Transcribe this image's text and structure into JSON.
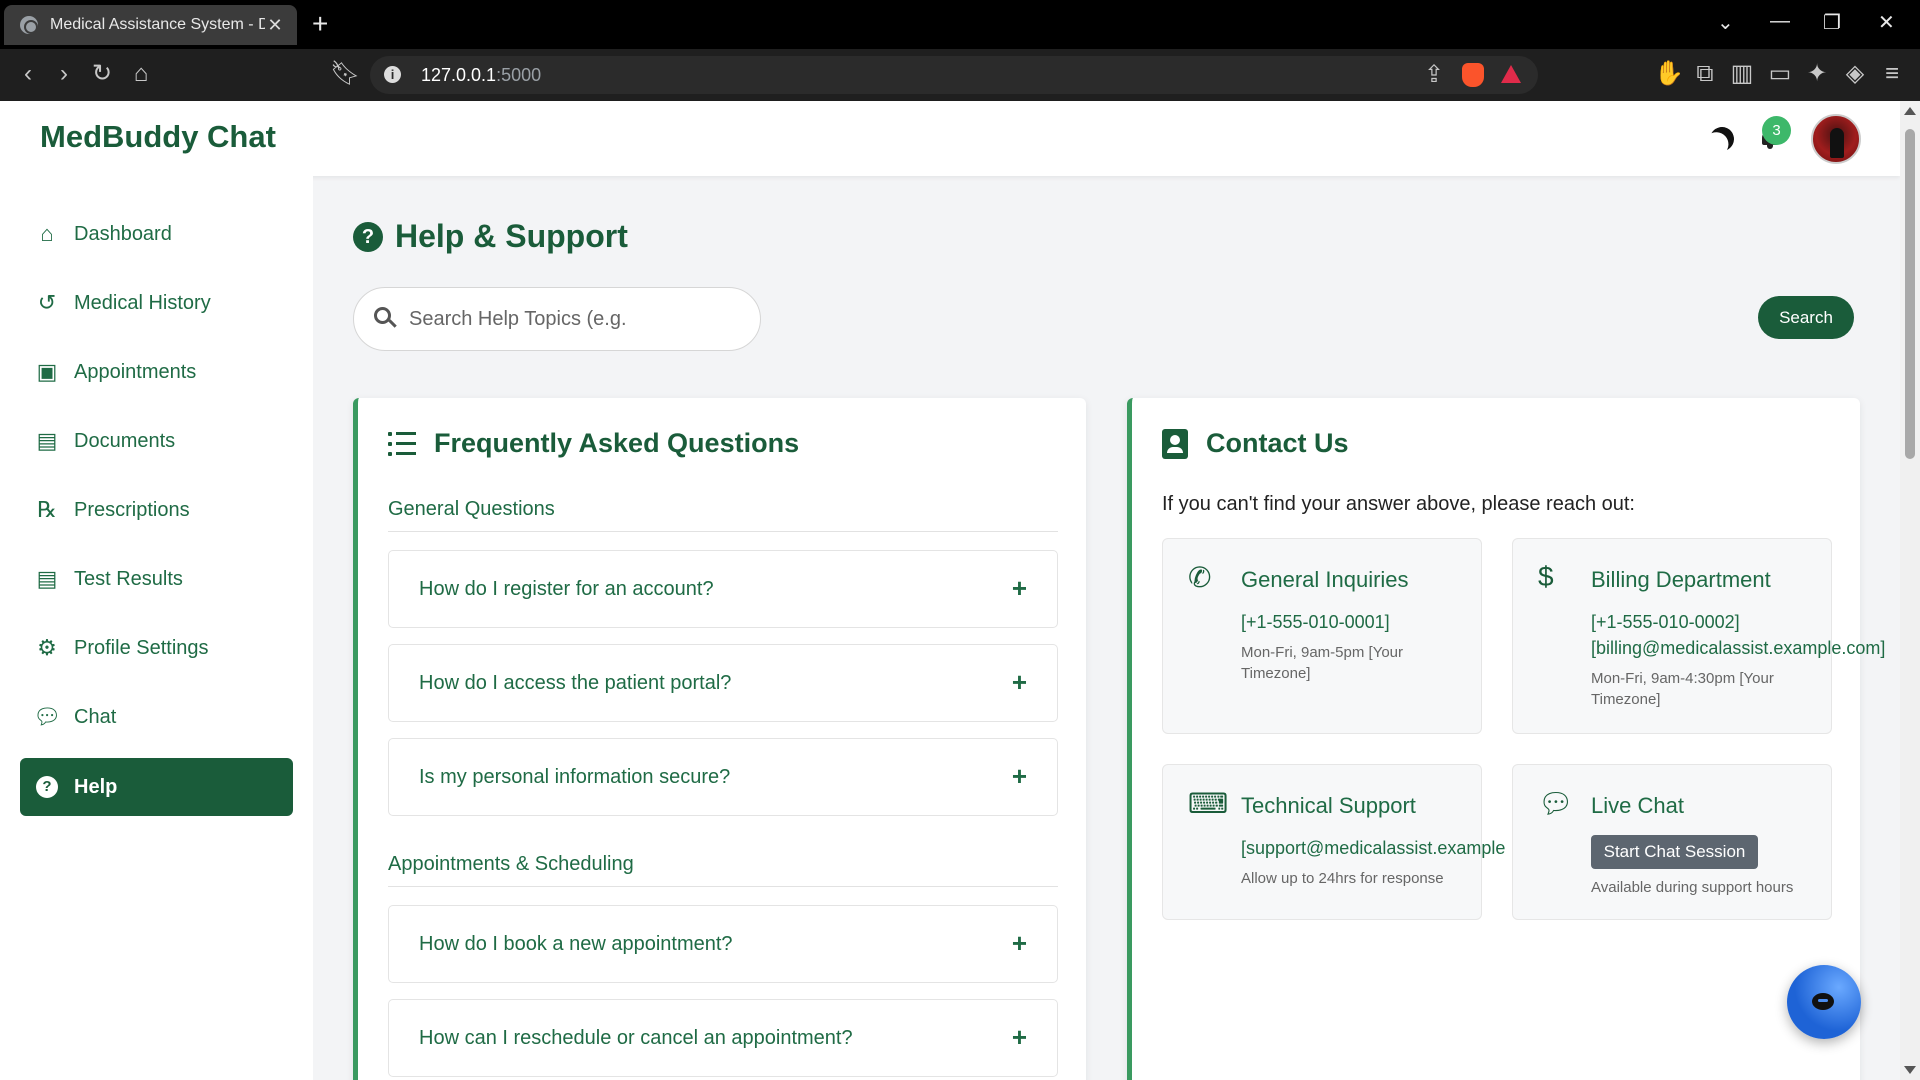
{
  "browser": {
    "tab_title": "Medical Assistance System - Dashboard",
    "url_host": "127.0.0.1",
    "url_port": ":5000"
  },
  "header": {
    "brand": "MedBuddy Chat",
    "notification_count": "3"
  },
  "sidebar": {
    "items": [
      {
        "label": "Dashboard",
        "icon": "home-icon"
      },
      {
        "label": "Medical History",
        "icon": "history-icon"
      },
      {
        "label": "Appointments",
        "icon": "calendar-check-icon"
      },
      {
        "label": "Documents",
        "icon": "file-icon"
      },
      {
        "label": "Prescriptions",
        "icon": "prescription-icon"
      },
      {
        "label": "Test Results",
        "icon": "file-medical-icon"
      },
      {
        "label": "Profile Settings",
        "icon": "user-cog-icon"
      },
      {
        "label": "Chat",
        "icon": "comments-icon"
      },
      {
        "label": "Help",
        "icon": "question-circle-icon",
        "active": true
      }
    ]
  },
  "main": {
    "title": "Help & Support",
    "search_placeholder": "Search Help Topics (e.g.",
    "search_button": "Search"
  },
  "faq": {
    "title": "Frequently Asked Questions",
    "sections": [
      {
        "name": "General Questions",
        "questions": [
          "How do I register for an account?",
          "How do I access the patient portal?",
          "Is my personal information secure?"
        ]
      },
      {
        "name": "Appointments & Scheduling",
        "questions": [
          "How do I book a new appointment?",
          "How can I reschedule or cancel an appointment?"
        ]
      }
    ]
  },
  "contact": {
    "title": "Contact Us",
    "intro": "If you can't find your answer above, please reach out:",
    "boxes": [
      {
        "title": "General Inquiries",
        "lines": [
          "[+1-555-010-0001]"
        ],
        "note": "Mon-Fri, 9am-5pm [Your Timezone]",
        "icon": "phone-icon"
      },
      {
        "title": "Billing Department",
        "lines": [
          "[+1-555-010-0002]",
          "[billing@medicalassist.example.com]"
        ],
        "note": "Mon-Fri, 9am-4:30pm [Your Timezone]",
        "icon": "invoice-dollar-icon"
      },
      {
        "title": "Technical Support",
        "lines": [
          "[support@medicalassist.example"
        ],
        "note": "Allow up to 24hrs for response",
        "icon": "laptop-code-icon"
      },
      {
        "title": "Live Chat",
        "button": "Start Chat Session",
        "note": "Available during support hours",
        "icon": "comments-icon"
      }
    ]
  },
  "colors": {
    "primary": "#1a5c3a",
    "accent_border": "#3a9a60",
    "badge": "#3db86a",
    "fab": "#1e63d6"
  }
}
